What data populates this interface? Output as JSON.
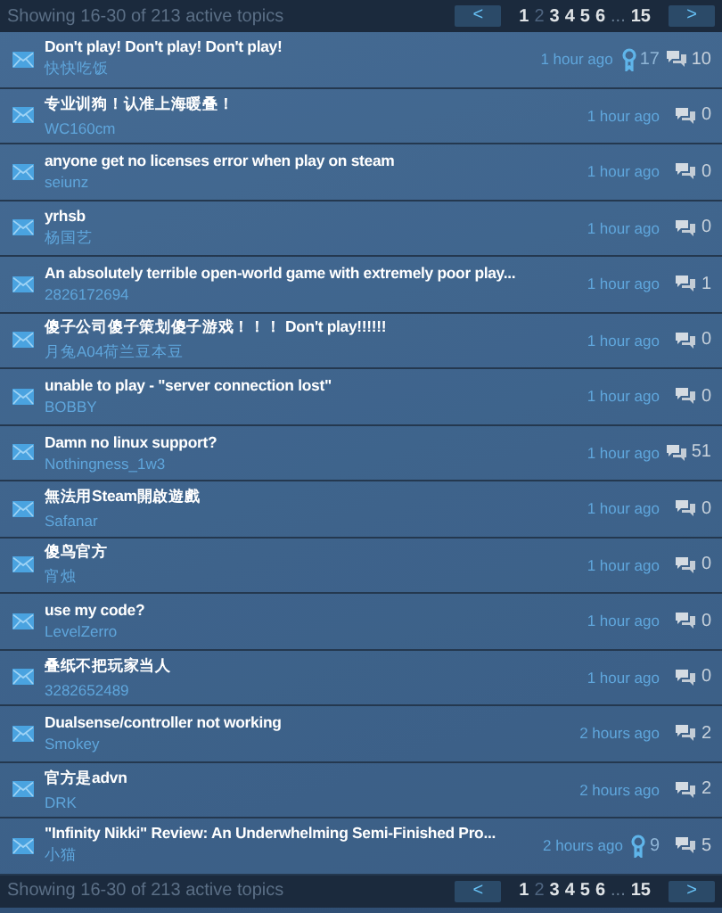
{
  "pager_top": {
    "summary": "Showing 16-30 of 213 active topics",
    "prev": "<",
    "next": ">",
    "pages": [
      {
        "label": "1",
        "selected": false
      },
      {
        "label": "2",
        "selected": true
      },
      {
        "label": "3",
        "selected": false
      },
      {
        "label": "4",
        "selected": false
      },
      {
        "label": "5",
        "selected": false
      },
      {
        "label": "6",
        "selected": false
      },
      {
        "label": "...",
        "selected": false
      },
      {
        "label": "15",
        "selected": false
      }
    ]
  },
  "topics": [
    {
      "title": "Don't play! Don't play! Don't play!",
      "author": "快快吃饭",
      "time": "1 hour ago",
      "awards": "17",
      "replies": "10"
    },
    {
      "title": "专业训狗！认准上海暖叠！",
      "author": "WC160cm",
      "time": "1 hour ago",
      "replies": "0"
    },
    {
      "title": "anyone get no licenses error when play on steam",
      "author": "seiunz",
      "time": "1 hour ago",
      "replies": "0"
    },
    {
      "title": "yrhsb",
      "author": "杨国艺",
      "time": "1 hour ago",
      "replies": "0"
    },
    {
      "title": "An absolutely terrible open-world game with extremely poor play...",
      "author": "2826172694",
      "time": "1 hour ago",
      "replies": "1"
    },
    {
      "title": "傻子公司傻子策划傻子游戏！！！ Don't play!!!!!!",
      "author": "月兔A04荷兰豆本豆",
      "time": "1 hour ago",
      "replies": "0"
    },
    {
      "title": "unable to play - \"server connection lost\"",
      "author": "BOBBY",
      "time": "1 hour ago",
      "replies": "0"
    },
    {
      "title": "Damn no linux support?",
      "author": "Nothingness_1w3",
      "time": "1 hour ago",
      "replies": "51"
    },
    {
      "title": "無法用Steam開啟遊戲",
      "author": "Safanar",
      "time": "1 hour ago",
      "replies": "0"
    },
    {
      "title": "傻鸟官方",
      "author": "宵烛",
      "time": "1 hour ago",
      "replies": "0"
    },
    {
      "title": "use my code?",
      "author": "LevelZerro",
      "time": "1 hour ago",
      "replies": "0"
    },
    {
      "title": "叠纸不把玩家当人",
      "author": "3282652489",
      "time": "1 hour ago",
      "replies": "0"
    },
    {
      "title": "Dualsense/controller not working",
      "author": "Smokey",
      "time": "2 hours ago",
      "replies": "2"
    },
    {
      "title": "官方是advn",
      "author": "DRK",
      "time": "2 hours ago",
      "replies": "2"
    },
    {
      "title": "\"Infinity Nikki\" Review: An Underwhelming Semi-Finished Pro...",
      "author": "小猫",
      "time": "2 hours ago",
      "awards": "9",
      "replies": "5"
    }
  ],
  "pager_bottom": {
    "summary": "Showing 16-30 of 213 active topics",
    "prev": "<",
    "next": ">",
    "pages": [
      {
        "label": "1",
        "selected": false
      },
      {
        "label": "2",
        "selected": true
      },
      {
        "label": "3",
        "selected": false
      },
      {
        "label": "4",
        "selected": false
      },
      {
        "label": "5",
        "selected": false
      },
      {
        "label": "6",
        "selected": false
      },
      {
        "label": "...",
        "selected": false
      },
      {
        "label": "15",
        "selected": false
      }
    ]
  }
}
